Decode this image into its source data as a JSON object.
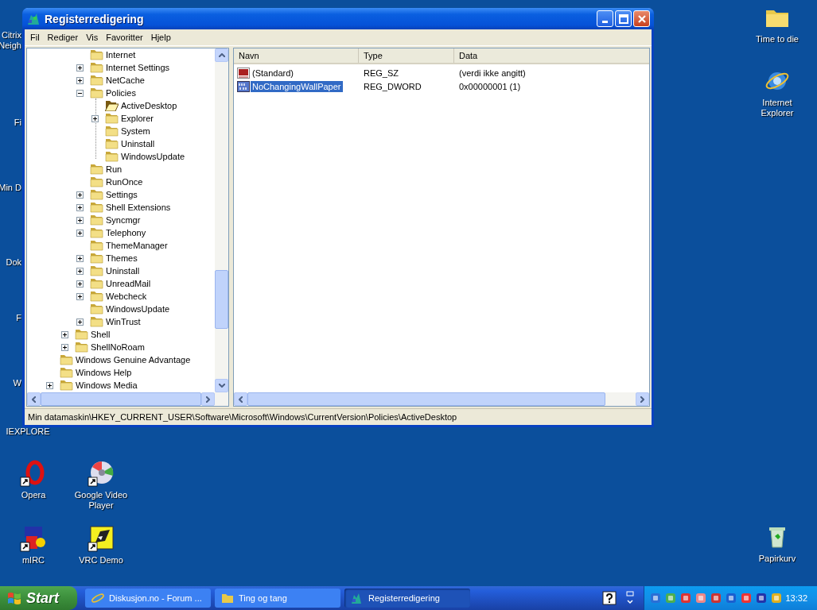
{
  "desktop_icons": [
    {
      "label": "Citrix\nNeigh",
      "kind": "partial"
    },
    {
      "label": "Fi",
      "kind": "partial"
    },
    {
      "label": "Min D",
      "kind": "partial"
    },
    {
      "label": "Dok",
      "kind": "partial"
    },
    {
      "label": "F",
      "kind": "partial"
    },
    {
      "label": "W",
      "kind": "partial"
    },
    {
      "label": "IEXPLORE",
      "kind": "partial"
    },
    {
      "label": "Time to die",
      "kind": "folder",
      "shortcut": false
    },
    {
      "label": "Internet\nExplorer",
      "kind": "browser",
      "shortcut": false
    },
    {
      "label": "Opera",
      "kind": "opera",
      "shortcut": true
    },
    {
      "label": "Google Video\nPlayer",
      "kind": "disc",
      "shortcut": true
    },
    {
      "label": "mIRC",
      "kind": "mirc",
      "shortcut": true
    },
    {
      "label": "VRC Demo",
      "kind": "flag",
      "shortcut": true
    },
    {
      "label": "Papirkurv",
      "kind": "bin",
      "shortcut": false
    }
  ],
  "window": {
    "title": "Registerredigering",
    "menu": [
      "Fil",
      "Rediger",
      "Vis",
      "Favoritter",
      "Hjelp"
    ],
    "tree": [
      {
        "children": [
          {
            "children": [
              {
                "label": "Internet",
                "expandable": false,
                "selected": false
              },
              {
                "label": "Internet Settings",
                "expandable": true,
                "expanded": false,
                "selected": false
              },
              {
                "label": "NetCache",
                "expandable": true,
                "expanded": false,
                "selected": false
              },
              {
                "label": "Policies",
                "expandable": true,
                "expanded": true,
                "selected": false,
                "children": [
                  {
                    "label": "ActiveDesktop",
                    "expandable": false,
                    "selected": true
                  },
                  {
                    "label": "Explorer",
                    "expandable": true,
                    "expanded": false,
                    "selected": false
                  },
                  {
                    "label": "System",
                    "expandable": false,
                    "selected": false
                  },
                  {
                    "label": "Uninstall",
                    "expandable": false,
                    "selected": false
                  },
                  {
                    "label": "WindowsUpdate",
                    "expandable": false,
                    "selected": false
                  }
                ]
              },
              {
                "label": "Run",
                "expandable": false,
                "selected": false
              },
              {
                "label": "RunOnce",
                "expandable": false,
                "selected": false
              },
              {
                "label": "Settings",
                "expandable": true,
                "expanded": false,
                "selected": false
              },
              {
                "label": "Shell Extensions",
                "expandable": true,
                "expanded": false,
                "selected": false
              },
              {
                "label": "Syncmgr",
                "expandable": true,
                "expanded": false,
                "selected": false
              },
              {
                "label": "Telephony",
                "expandable": true,
                "expanded": false,
                "selected": false
              },
              {
                "label": "ThemeManager",
                "expandable": false,
                "selected": false
              },
              {
                "label": "Themes",
                "expandable": true,
                "expanded": false,
                "selected": false
              },
              {
                "label": "Uninstall",
                "expandable": true,
                "expanded": false,
                "selected": false
              },
              {
                "label": "UnreadMail",
                "expandable": true,
                "expanded": false,
                "selected": false
              },
              {
                "label": "Webcheck",
                "expandable": true,
                "expanded": false,
                "selected": false
              },
              {
                "label": "WindowsUpdate",
                "expandable": false,
                "selected": false
              },
              {
                "label": "WinTrust",
                "expandable": true,
                "expanded": false,
                "selected": false
              }
            ]
          },
          {
            "label": "Shell",
            "expandable": true,
            "expanded": false,
            "selected": false
          },
          {
            "label": "ShellNoRoam",
            "expandable": true,
            "expanded": false,
            "selected": false
          }
        ]
      },
      {
        "label": "Windows Genuine Advantage",
        "expandable": false,
        "selected": false
      },
      {
        "label": "Windows Help",
        "expandable": false,
        "selected": false
      },
      {
        "label": "Windows Media",
        "expandable": true,
        "expanded": false,
        "selected": false
      }
    ],
    "columns": [
      "Navn",
      "Type",
      "Data"
    ],
    "values": [
      {
        "kind": "string",
        "name": "(Standard)",
        "type": "REG_SZ",
        "data": "(verdi ikke angitt)",
        "selected": false
      },
      {
        "kind": "binary",
        "name": "NoChangingWallPaper",
        "type": "REG_DWORD",
        "data": "0x00000001 (1)",
        "selected": true
      }
    ],
    "status_bar": "Min datamaskin\\HKEY_CURRENT_USER\\Software\\Microsoft\\Windows\\CurrentVersion\\Policies\\ActiveDesktop"
  },
  "taskbar": {
    "start": "Start",
    "tasks": [
      {
        "label": "Diskusjon.no - Forum ...",
        "kind": "browser",
        "selected": false
      },
      {
        "label": "Ting og tang",
        "kind": "folder",
        "selected": false
      },
      {
        "label": "Registerredigering",
        "kind": "regedit",
        "selected": true
      }
    ],
    "clock": "13:32"
  }
}
